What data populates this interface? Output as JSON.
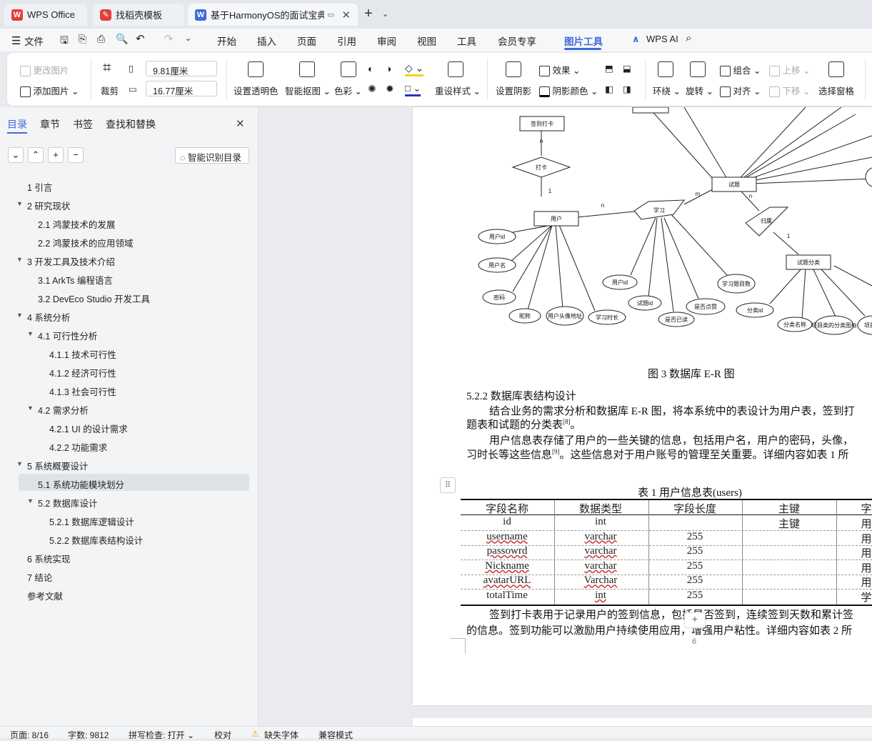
{
  "tabs": [
    {
      "label": "WPS Office"
    },
    {
      "label": "找稻壳模板"
    },
    {
      "label": "基于HarmonyOS的面试宝典a"
    }
  ],
  "menu": {
    "file": "文件",
    "items": [
      "开始",
      "插入",
      "页面",
      "引用",
      "审阅",
      "视图",
      "工具",
      "会员专享",
      "图片工具"
    ],
    "wps_ai": "WPS AI"
  },
  "ribbon": {
    "change_pic": "更改图片",
    "add_pic": "添加图片",
    "crop": "裁剪",
    "width": "9.81厘米",
    "height": "16.77厘米",
    "transparent": "设置透明色",
    "smart_cutout": "智能抠图",
    "color": "色彩",
    "reset_style": "重设样式",
    "set_shadow": "设置阴影",
    "effect": "效果",
    "shadow_color": "阴影颜色",
    "wrap": "环绕",
    "rotate": "旋转",
    "group": "组合",
    "align": "对齐",
    "bring_forward": "上移",
    "send_backward": "下移",
    "selection_pane": "选择窗格"
  },
  "panel": {
    "tabs": [
      "目录",
      "章节",
      "书签",
      "查找和替换"
    ],
    "smart_toc": "智能识别目录",
    "toc": [
      "1 引言",
      "2 研究现状",
      "2.1 鸿蒙技术的发展",
      "2.2 鸿蒙技术的应用领域",
      "3 开发工具及技术介绍",
      "3.1 ArkTs 编程语言",
      "3.2 DevEco Studio 开发工具",
      "4 系统分析",
      "4.1 可行性分析",
      "4.1.1 技术可行性",
      "4.1.2 经济可行性",
      "4.1.3 社会可行性",
      "4.2 需求分析",
      "4.2.1 UI 的设计需求",
      "4.2.2 功能需求",
      "5 系统概要设计",
      "5.1 系统功能模块划分",
      "5.2 数据库设计",
      "5.2.1 数据库逻辑设计",
      "5.2.2 数据库表结构设计",
      "6 系统实现",
      "7 结论",
      "参考文献"
    ]
  },
  "er": {
    "entities": [
      "签到打卡",
      "用户",
      "试题",
      "试题分类"
    ],
    "relations": [
      "打卡",
      "学习",
      "归属"
    ],
    "attrs": [
      "用户id",
      "用户名",
      "密码",
      "昵称",
      "用户头像地址",
      "学习时长",
      "用户id",
      "试题id",
      "是否已读",
      "是否点赞",
      "学习题目数",
      "分类id",
      "分类名称",
      "项目类的分类图标",
      "项目"
    ],
    "cards": [
      "n",
      "1",
      "n",
      "m",
      "n",
      "1"
    ]
  },
  "doc": {
    "caption": "图 3 数据库 E-R 图",
    "heading": "5.2.2 数据库表结构设计",
    "p1a": "结合业务的需求分析和数据库 E-R 图，将本系统中的表设计为用户表，签到打",
    "p1b": "题表和试题的分类表",
    "p1ref": "[8]",
    "p1c": "。",
    "p2a": "用户信息表存储了用户的一些关键的信息，包括用户名，用户的密码，头像，",
    "p2b": "习时长等这些信息",
    "p2ref": "[9]",
    "p2c": "。这些信息对于用户账号的管理至关重要。详细内容如表 1 所",
    "table_caption": "表 1 用户信息表(users)",
    "headers": [
      "字段名称",
      "数据类型",
      "字段长度",
      "主键",
      "字"
    ],
    "rows": [
      [
        "id",
        "int",
        "",
        "主键",
        "用"
      ],
      [
        "username",
        "varchar",
        "255",
        "",
        "用"
      ],
      [
        "passowrd",
        "varchar",
        "255",
        "",
        "用"
      ],
      [
        "Nickname",
        "varchar",
        "255",
        "",
        "用"
      ],
      [
        "avatarURL",
        "Varchar",
        "255",
        "",
        "用"
      ],
      [
        "totalTime",
        "int",
        "255",
        "",
        "学"
      ]
    ],
    "p3a": "签到打卡表用于记录用户的签到信息，包括是否签到，连续签到天数和累计签",
    "p3b": "的信息。签到功能可以激励用户持续使用应用，增强用户粘性。详细内容如表 2 所",
    "page_no": "6"
  },
  "status": {
    "page": "页面: 8/16",
    "words": "字数: 9812",
    "spell": "拼写检查: 打开",
    "proof": "校对",
    "missing_font": "缺失字体",
    "compat": "兼容模式"
  },
  "colors": {
    "accent": "#3f6bd8",
    "wps_red": "#e23e3e"
  }
}
